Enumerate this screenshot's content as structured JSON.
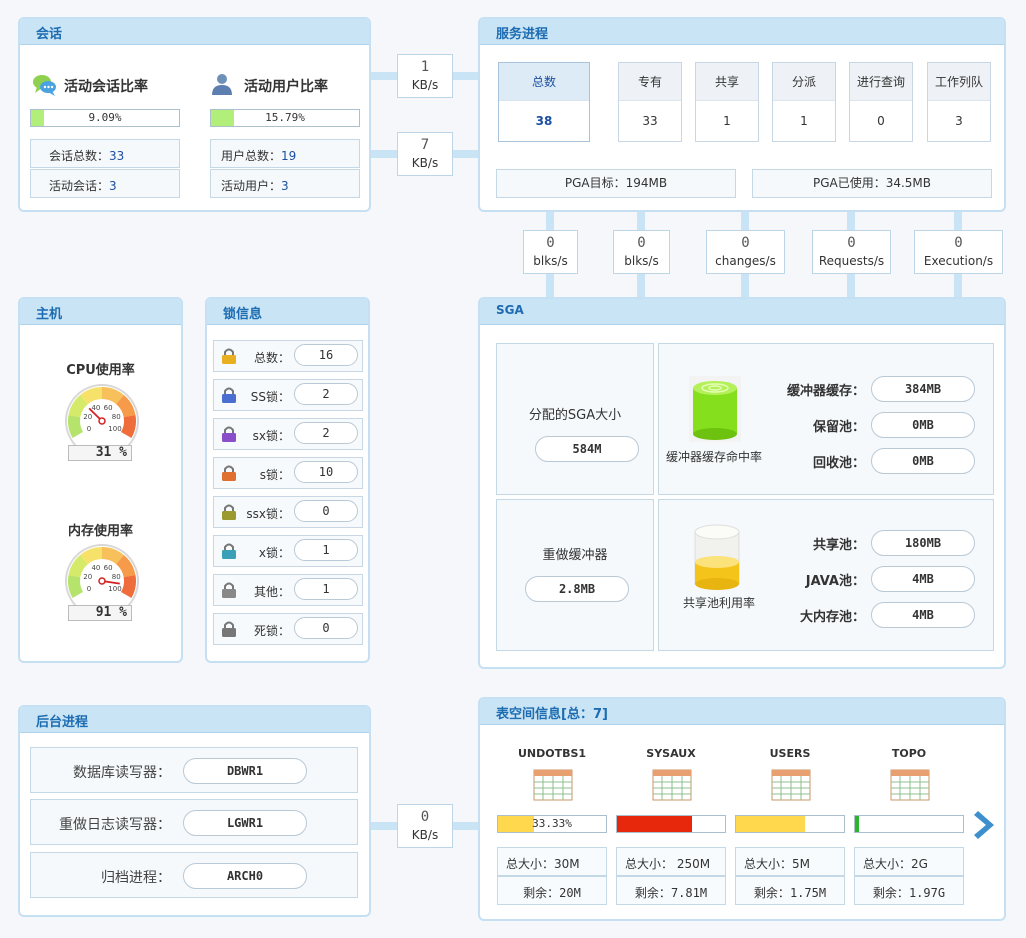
{
  "session": {
    "title": "会话",
    "ratio_title": "活动会话比率",
    "ratio": "9.09%",
    "ratio_value": 0.0909,
    "total_label": "会话总数：",
    "total": "33",
    "active_label": "活动会话：",
    "active": "3"
  },
  "users": {
    "ratio_title": "活动用户比率",
    "ratio": "15.79%",
    "ratio_value": 0.1579,
    "total_label": "用户总数：",
    "total": "19",
    "active_label": "活动用户：",
    "active": "3"
  },
  "rates_top": [
    {
      "value": "1",
      "unit": "KB/s"
    },
    {
      "value": "7",
      "unit": "KB/s"
    }
  ],
  "service": {
    "title": "服务进程",
    "items": [
      {
        "label": "总数",
        "value": "38"
      },
      {
        "label": "专有",
        "value": "33"
      },
      {
        "label": "共享",
        "value": "1"
      },
      {
        "label": "分派",
        "value": "1"
      },
      {
        "label": "进行查询",
        "value": "0"
      },
      {
        "label": "工作列队",
        "value": "3"
      }
    ],
    "pga_target": "PGA目标：194MB",
    "pga_used": "PGA已使用：34.5MB"
  },
  "io_rates": [
    {
      "value": "0",
      "unit": "blks/s"
    },
    {
      "value": "0",
      "unit": "blks/s"
    },
    {
      "value": "0",
      "unit": "changes/s"
    },
    {
      "value": "0",
      "unit": "Requests/s"
    },
    {
      "value": "0",
      "unit": "Execution/s"
    }
  ],
  "host": {
    "title": "主机",
    "cpu_title": "CPU使用率",
    "cpu_value": "31 %",
    "cpu_pct": 31,
    "mem_title": "内存使用率",
    "mem_value": "91 %",
    "mem_pct": 91,
    "gauge_ticks": [
      "0",
      "20",
      "40",
      "60",
      "80",
      "100"
    ]
  },
  "locks": {
    "title": "锁信息",
    "items": [
      {
        "label": "总数：",
        "value": "16",
        "icon": "lock-gold-icon"
      },
      {
        "label": "SS锁：",
        "value": "2",
        "icon": "lock-ss-icon"
      },
      {
        "label": "sx锁：",
        "value": "2",
        "icon": "lock-sx-icon"
      },
      {
        "label": "s锁：",
        "value": "10",
        "icon": "lock-s-icon"
      },
      {
        "label": "ssx锁：",
        "value": "0",
        "icon": "lock-ssx-icon"
      },
      {
        "label": "x锁：",
        "value": "1",
        "icon": "lock-x-icon"
      },
      {
        "label": "其他：",
        "value": "1",
        "icon": "lock-other-icon"
      },
      {
        "label": "死锁：",
        "value": "0",
        "icon": "lock-dead-icon"
      }
    ]
  },
  "sga": {
    "title": "SGA",
    "alloc_label": "分配的SGA大小",
    "alloc_value": "584M",
    "buffer_hit_label": "缓冲器缓存命中率",
    "buffer_cache_label": "缓冲器缓存：",
    "buffer_cache": "384MB",
    "keep_label": "保留池：",
    "keep": "0MB",
    "recycle_label": "回收池：",
    "recycle": "0MB",
    "redo_label": "重做缓冲器",
    "redo_value": "2.8MB",
    "shared_usage_label": "共享池利用率",
    "shared_label": "共享池：",
    "shared": "180MB",
    "java_label": "JAVA池：",
    "java": "4MB",
    "large_label": "大内存池：",
    "large": "4MB"
  },
  "background": {
    "title": "后台进程",
    "items": [
      {
        "label": "数据库读写器：",
        "value": "DBWR1"
      },
      {
        "label": "重做日志读写器：",
        "value": "LGWR1"
      },
      {
        "label": "归档进程：",
        "value": "ARCH0"
      }
    ],
    "rate": {
      "value": "0",
      "unit": "KB/s"
    }
  },
  "tablespace": {
    "title": "表空间信息[总：7]",
    "items": [
      {
        "name": "UNDOTBS1",
        "usage": "33.33%",
        "usage_value": 0.3333,
        "total": "总大小：30M",
        "free_label": "剩余：",
        "free": "20M",
        "bar_color": "#ffd84d"
      },
      {
        "name": "SYSAUX",
        "usage": "",
        "usage_value": 0.69,
        "total": "总大小：  250M",
        "free_label": "剩余：",
        "free": "7.81M",
        "bar_color": "#e8280c"
      },
      {
        "name": "USERS",
        "usage": "",
        "usage_value": 0.64,
        "total": "总大小：5M",
        "free_label": "剩余：",
        "free": "1.75M",
        "bar_color": "#ffd84d"
      },
      {
        "name": "TOPO",
        "usage": "",
        "usage_value": 0.04,
        "total": "总大小：2G",
        "free_label": "剩余：",
        "free": "1.97G",
        "bar_color": "#2db42d"
      }
    ]
  }
}
